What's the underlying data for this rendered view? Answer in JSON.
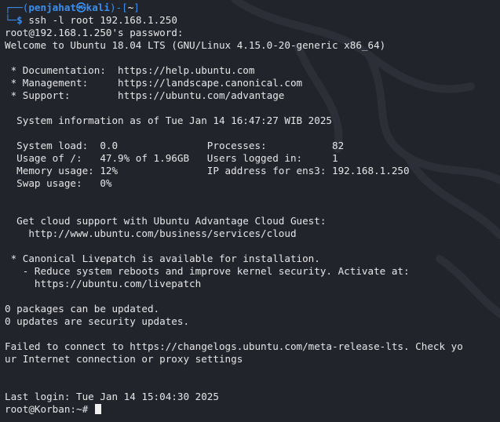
{
  "prompt": {
    "frame_top": "┌──(",
    "user": "penjahat",
    "at_symbol": "㉿",
    "host": "kali",
    "sep": ")-[",
    "cwd": "~",
    "close": "]",
    "frame_bottom": "└─",
    "dollar": "$",
    "command": " ssh -l root 192.168.1.250"
  },
  "output": {
    "password_prompt": "root@192.168.1.250's password:",
    "welcome": "Welcome to Ubuntu 18.04 LTS (GNU/Linux 4.15.0-20-generic x86_64)",
    "doc_line": " * Documentation:  https://help.ubuntu.com",
    "mgmt_line": " * Management:     https://landscape.canonical.com",
    "support_line": " * Support:        https://ubuntu.com/advantage",
    "sysinfo_header": "  System information as of Tue Jan 14 16:47:27 WIB 2025",
    "stats_row1": "  System load:  0.0               Processes:           82",
    "stats_row2": "  Usage of /:   47.9% of 1.96GB   Users logged in:     1",
    "stats_row3": "  Memory usage: 12%               IP address for ens3: 192.168.1.250",
    "stats_row4": "  Swap usage:   0%",
    "cloud_line1": "  Get cloud support with Ubuntu Advantage Cloud Guest:",
    "cloud_line2": "    http://www.ubuntu.com/business/services/cloud",
    "livepatch_line1": " * Canonical Livepatch is available for installation.",
    "livepatch_line2": "   - Reduce system reboots and improve kernel security. Activate at:",
    "livepatch_line3": "     https://ubuntu.com/livepatch",
    "packages_line": "0 packages can be updated.",
    "security_line": "0 updates are security updates.",
    "failed_line1": "Failed to connect to https://changelogs.ubuntu.com/meta-release-lts. Check yo",
    "failed_line2": "ur Internet connection or proxy settings",
    "last_login": "Last login: Tue Jan 14 15:04:30 2025",
    "root_prompt": "root@Korban:~# "
  },
  "colors": {
    "background": "#22242c",
    "prompt_blue": "#3b8eea",
    "text": "#e6e6e6"
  },
  "icons": {
    "background_logo": "kali-dragon-icon"
  }
}
